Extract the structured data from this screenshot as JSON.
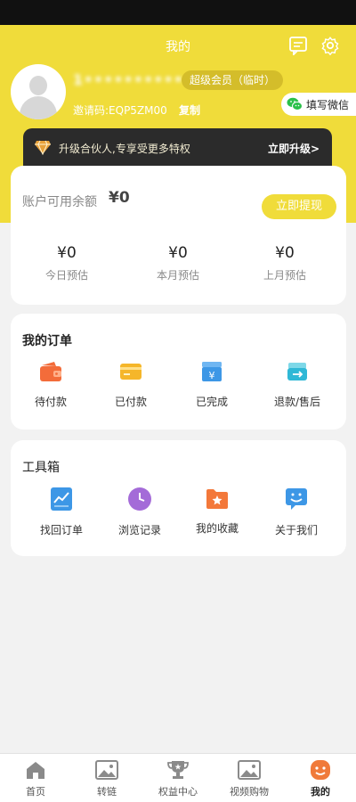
{
  "header": {
    "title": "我的",
    "username": "1•••••••••••0",
    "member_badge": "超级会员（临时）",
    "invite_code": "邀请码:EQP5ZM00",
    "copy_label": "复制",
    "wechat_label": "填写微信"
  },
  "vip_banner": {
    "text": "升级合伙人,专享受更多特权",
    "action": "立即升级>"
  },
  "balance": {
    "label": "账户可用余额",
    "value": "¥0",
    "withdraw_label": "立即提现",
    "stats": [
      {
        "value": "¥0",
        "label": "今日预估"
      },
      {
        "value": "¥0",
        "label": "本月预估"
      },
      {
        "value": "¥0",
        "label": "上月预估"
      }
    ]
  },
  "orders": {
    "title": "我的订单",
    "items": [
      {
        "label": "待付款",
        "icon": "wallet-icon"
      },
      {
        "label": "已付款",
        "icon": "card-icon"
      },
      {
        "label": "已完成",
        "icon": "yen-box-icon"
      },
      {
        "label": "退款/售后",
        "icon": "refund-icon"
      }
    ]
  },
  "tools": {
    "title": "工具箱",
    "items": [
      {
        "label": "找回订单",
        "icon": "chart-icon"
      },
      {
        "label": "浏览记录",
        "icon": "clock-icon"
      },
      {
        "label": "我的收藏",
        "icon": "star-folder-icon"
      },
      {
        "label": "关于我们",
        "icon": "smile-chat-icon"
      }
    ]
  },
  "tabbar": [
    {
      "label": "首页",
      "icon": "home-icon"
    },
    {
      "label": "转链",
      "icon": "image-icon"
    },
    {
      "label": "权益中心",
      "icon": "trophy-icon"
    },
    {
      "label": "视频购物",
      "icon": "video-image-icon"
    },
    {
      "label": "我的",
      "icon": "profile-face-icon"
    }
  ],
  "colors": {
    "brand_yellow": "#f0dc3a",
    "active_orange": "#f07a3a"
  }
}
